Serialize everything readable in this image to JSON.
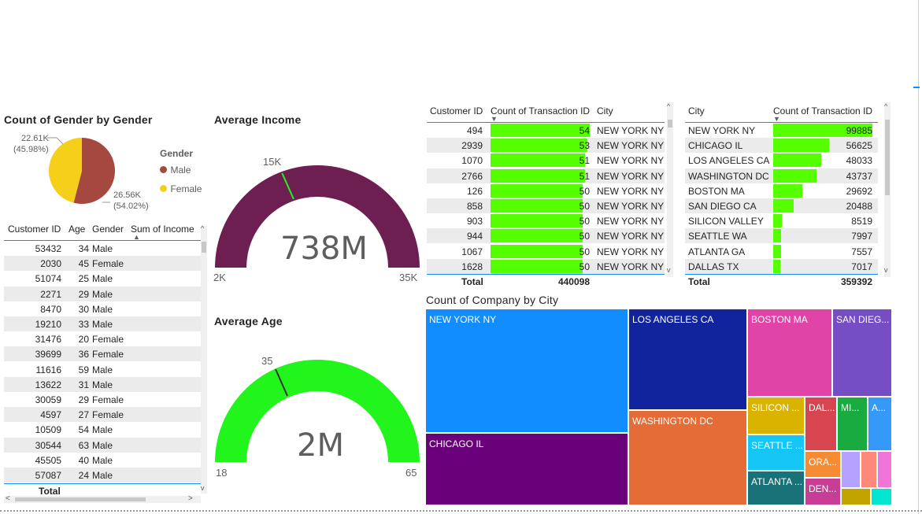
{
  "pie": {
    "title": "Count of Gender by Gender",
    "legend_title": "Gender",
    "legend": [
      {
        "label": "Male",
        "color": "#A5483F"
      },
      {
        "label": "Female",
        "color": "#F5CF1A"
      }
    ],
    "label_female_value": "22.61K",
    "label_female_pct": "(45.98%)",
    "label_male_value": "26.56K",
    "label_male_pct": "(54.02%)"
  },
  "customer_table": {
    "headers": [
      "Customer ID",
      "Age",
      "Gender",
      "Sum of Income ("
    ],
    "rows": [
      [
        "53432",
        "34",
        "Male"
      ],
      [
        "2030",
        "45",
        "Female"
      ],
      [
        "51074",
        "25",
        "Male"
      ],
      [
        "2271",
        "29",
        "Male"
      ],
      [
        "8470",
        "30",
        "Male"
      ],
      [
        "19210",
        "33",
        "Male"
      ],
      [
        "31476",
        "20",
        "Female"
      ],
      [
        "39699",
        "36",
        "Female"
      ],
      [
        "11616",
        "59",
        "Male"
      ],
      [
        "13622",
        "31",
        "Male"
      ],
      [
        "30059",
        "29",
        "Female"
      ],
      [
        "4597",
        "27",
        "Female"
      ],
      [
        "10509",
        "54",
        "Male"
      ],
      [
        "30544",
        "63",
        "Male"
      ],
      [
        "45505",
        "40",
        "Male"
      ],
      [
        "57087",
        "24",
        "Male"
      ]
    ],
    "total_label": "Total"
  },
  "income_gauge": {
    "title": "Average Income",
    "value": "738M",
    "min": "2K",
    "max": "35K",
    "target": "15K",
    "color": "#6E1F52"
  },
  "age_gauge": {
    "title": "Average Age",
    "value": "2M",
    "min": "18",
    "max": "65",
    "target": "35",
    "color": "#22F51C"
  },
  "transactions_table": {
    "headers": [
      "Customer ID",
      "Count of Transaction ID",
      "City"
    ],
    "rows": [
      {
        "id": "494",
        "count": "54",
        "city": "NEW YORK NY",
        "level": 1.0
      },
      {
        "id": "2939",
        "count": "53",
        "city": "NEW YORK NY",
        "level": 0.98
      },
      {
        "id": "1070",
        "count": "51",
        "city": "NEW YORK NY",
        "level": 0.95
      },
      {
        "id": "2766",
        "count": "51",
        "city": "NEW YORK NY",
        "level": 0.95
      },
      {
        "id": "126",
        "count": "50",
        "city": "NEW YORK NY",
        "level": 0.93
      },
      {
        "id": "858",
        "count": "50",
        "city": "NEW YORK NY",
        "level": 0.93
      },
      {
        "id": "903",
        "count": "50",
        "city": "NEW YORK NY",
        "level": 0.93
      },
      {
        "id": "944",
        "count": "50",
        "city": "NEW YORK NY",
        "level": 0.93
      },
      {
        "id": "1067",
        "count": "50",
        "city": "NEW YORK NY",
        "level": 0.93
      },
      {
        "id": "1628",
        "count": "50",
        "city": "NEW YORK NY",
        "level": 0.93
      }
    ],
    "total_label": "Total",
    "total_value": "440098",
    "bar_color": "#55FF00"
  },
  "city_table": {
    "headers": [
      "City",
      "Count of Transaction ID"
    ],
    "rows": [
      {
        "city": "NEW YORK NY",
        "count": "99885",
        "value": 99885
      },
      {
        "city": "CHICAGO IL",
        "count": "56625",
        "value": 56625
      },
      {
        "city": "LOS ANGELES CA",
        "count": "48033",
        "value": 48033
      },
      {
        "city": "WASHINGTON DC",
        "count": "43737",
        "value": 43737
      },
      {
        "city": "BOSTON MA",
        "count": "29692",
        "value": 29692
      },
      {
        "city": "SAN DIEGO CA",
        "count": "20488",
        "value": 20488
      },
      {
        "city": "SILICON VALLEY",
        "count": "8519",
        "value": 8519
      },
      {
        "city": "SEATTLE WA",
        "count": "7997",
        "value": 7997
      },
      {
        "city": "ATLANTA GA",
        "count": "7557",
        "value": 7557
      },
      {
        "city": "DALLAS TX",
        "count": "7017",
        "value": 7017
      }
    ],
    "total_label": "Total",
    "total_value": "359392",
    "bar_color": "#55FF00"
  },
  "treemap": {
    "title": "Count of Company by City",
    "labels": {
      "new_york": "NEW YORK NY",
      "chicago": "CHICAGO IL",
      "los_angeles": "LOS ANGELES CA",
      "washington": "WASHINGTON DC",
      "boston": "BOSTON MA",
      "san_diego": "SAN DIEG...",
      "silicon": "SILICON ...",
      "dal": "DAL...",
      "mi": "MI...",
      "a": "A...",
      "seattle": "SEATTLE ...",
      "atlanta": "ATLANTA ...",
      "ora": "ORA...",
      "den": "DEN..."
    },
    "colors": {
      "new_york": "#118DFF",
      "chicago": "#6B007B",
      "los_angeles": "#12239E",
      "washington": "#E66C37",
      "boston": "#E044A7",
      "san_diego": "#744EC2",
      "silicon": "#D9B300",
      "dal": "#D64550",
      "mi": "#1AAB40",
      "a": "#3599F7",
      "seattle": "#15C6F4",
      "atlanta": "#197278",
      "ora": "#F68B33",
      "den": "#C83D95",
      "s1": "#B5A1FF",
      "s2": "#FE8879",
      "s3": "#F074D9",
      "s4": "#C1A400",
      "s5": "#01E6D1"
    }
  }
}
